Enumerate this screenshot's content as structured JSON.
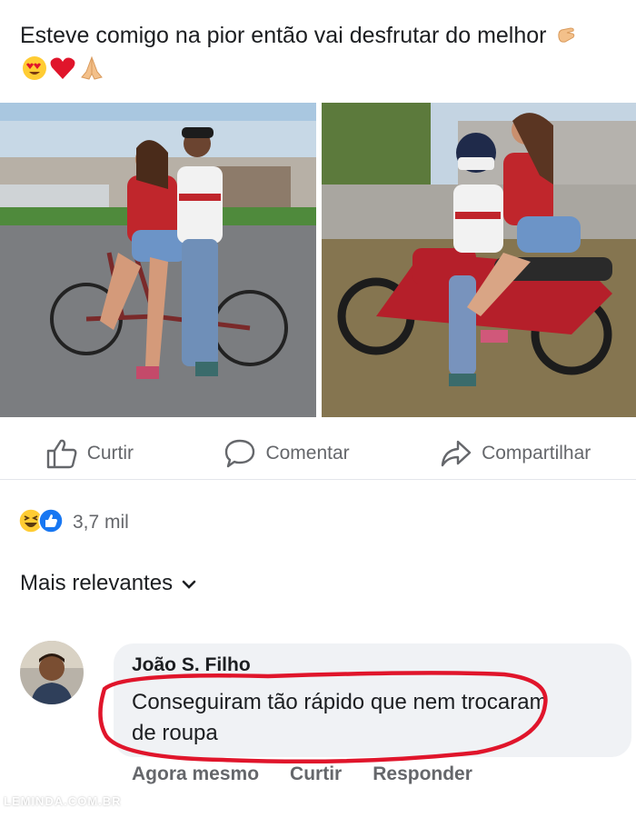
{
  "post": {
    "text": "Esteve comigo na pior então vai desfrutar do melhor",
    "emojis": [
      "call-me-hand-emoji",
      "heart-eyes-emoji",
      "red-heart-emoji",
      "folded-hands-emoji"
    ]
  },
  "actions": {
    "like_label": "Curtir",
    "comment_label": "Comentar",
    "share_label": "Compartilhar"
  },
  "reactions": {
    "icons": [
      "haha-reaction-icon",
      "like-reaction-icon"
    ],
    "count": "3,7 mil"
  },
  "comments_filter": {
    "label": "Mais relevantes"
  },
  "comment": {
    "author": "João S. Filho",
    "text": "Conseguiram tão rápido que nem trocaram de roupa",
    "time": "Agora mesmo",
    "like_label": "Curtir",
    "reply_label": "Responder"
  },
  "watermark": "LEMINDA.COM.BR",
  "colors": {
    "secondary_text": "#65676b",
    "bubble_bg": "#f0f2f5",
    "highlight_circle": "#e0152b",
    "like_blue": "#1877f2"
  }
}
